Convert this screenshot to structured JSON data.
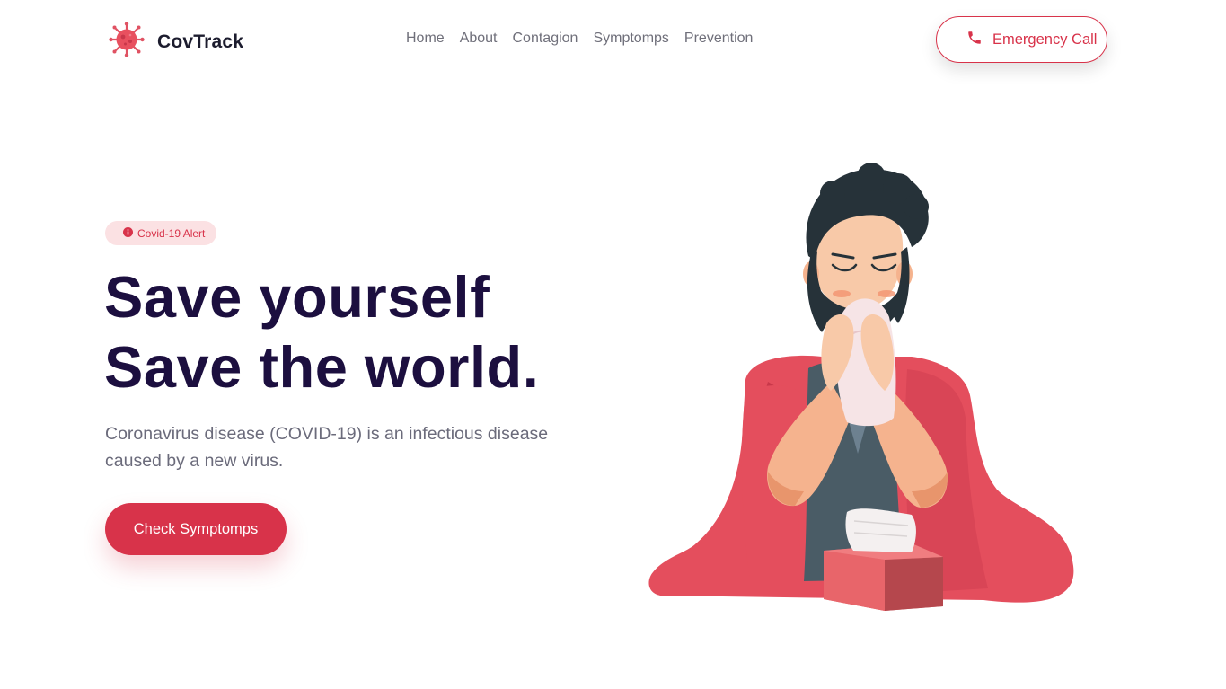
{
  "brand": {
    "name": "CovTrack",
    "logo_icon": "virus-icon"
  },
  "nav": {
    "links": [
      "Home",
      "About",
      "Contagion",
      "Symptomps",
      "Prevention"
    ]
  },
  "emergency": {
    "label": "Emergency Call",
    "icon": "phone-icon"
  },
  "hero": {
    "badge": {
      "label": "Covid-19 Alert",
      "icon": "info-icon"
    },
    "title_line1": "Save yourself",
    "title_line2": "Save the world.",
    "description": "Coronavirus disease (COVID-19) is an infectious disease caused by a new virus.",
    "cta_label": "Check Symptomps"
  },
  "colors": {
    "accent": "#d8334a",
    "heading": "#1c0f3f",
    "muted_text": "#6b6b7b",
    "badge_bg": "#fbe1e3"
  }
}
